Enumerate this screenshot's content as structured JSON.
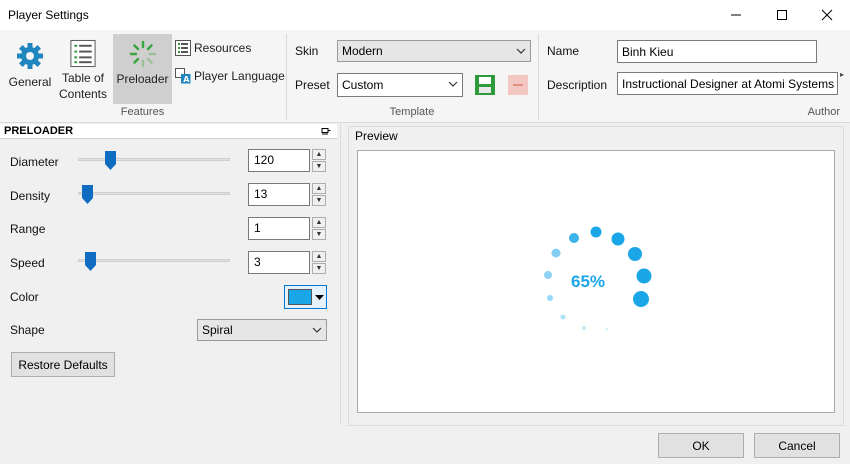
{
  "window": {
    "title": "Player Settings"
  },
  "ribbon": {
    "features": {
      "general": "General",
      "table_of_contents": "Table of\nContents",
      "preloader": "Preloader",
      "resources": "Resources",
      "player_language": "Player Language",
      "group_label": "Features"
    },
    "template": {
      "skin_label": "Skin",
      "skin_value": "Modern",
      "preset_label": "Preset",
      "preset_value": "Custom",
      "group_label": "Template"
    },
    "author": {
      "name_label": "Name",
      "name_value": "Binh Kieu",
      "description_label": "Description",
      "description_value": "Instructional Designer at Atomi Systems",
      "group_label": "Author"
    }
  },
  "preloader": {
    "header": "PRELOADER",
    "diameter": {
      "label": "Diameter",
      "value": "120"
    },
    "density": {
      "label": "Density",
      "value": "13"
    },
    "range": {
      "label": "Range",
      "value": "1"
    },
    "speed": {
      "label": "Speed",
      "value": "3"
    },
    "color": {
      "label": "Color",
      "value_hex": "#1ba6e8"
    },
    "shape": {
      "label": "Shape",
      "value": "Spiral"
    },
    "restore_defaults": "Restore Defaults"
  },
  "preview": {
    "label": "Preview",
    "percent": "65%",
    "accent": "#1ba6e8"
  },
  "footer": {
    "ok": "OK",
    "cancel": "Cancel"
  },
  "colors": {
    "accent": "#1ba6e8",
    "slider_thumb": "#0f6cc0"
  }
}
